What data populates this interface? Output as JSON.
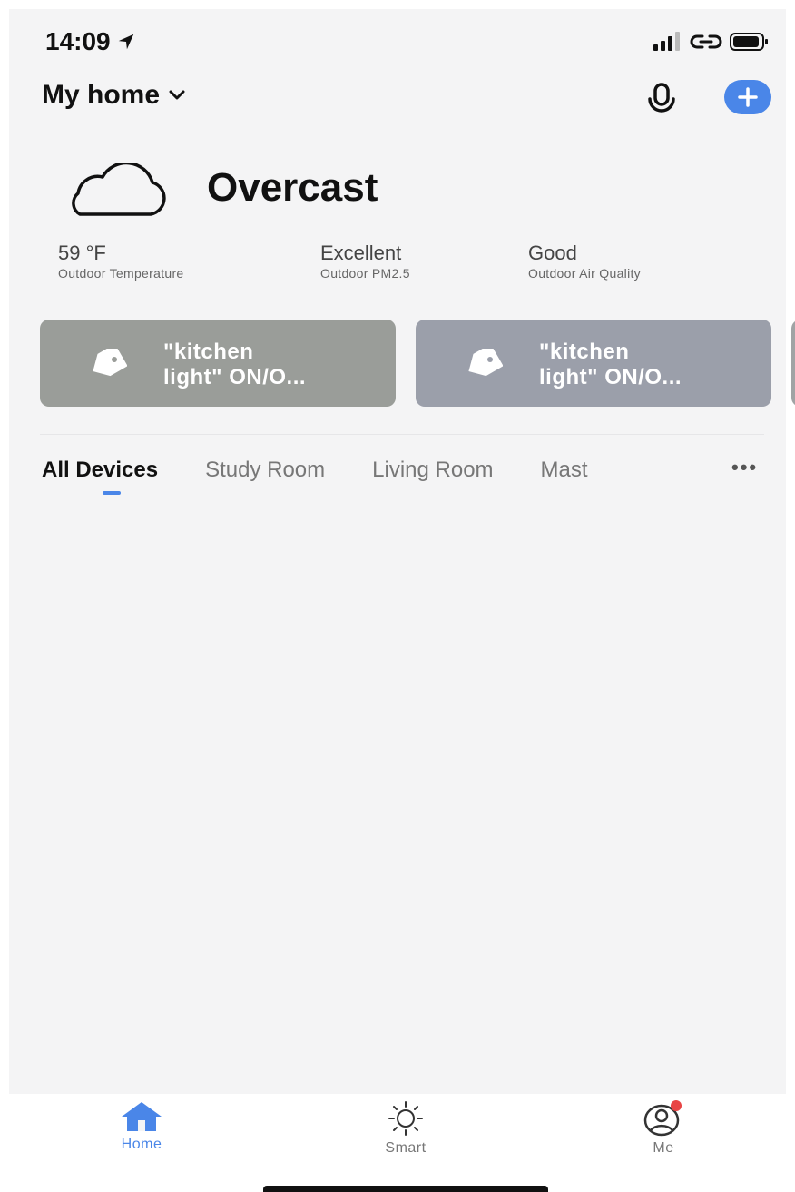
{
  "status_bar": {
    "time": "14:09",
    "icons": [
      "location-arrow-icon",
      "signal-icon",
      "link-icon",
      "battery-icon"
    ]
  },
  "header": {
    "title": "My home",
    "icons": [
      "chevron-down-icon",
      "microphone-icon",
      "plus-icon"
    ]
  },
  "weather": {
    "condition": "Overcast",
    "icon": "cloud-icon",
    "stats": [
      {
        "value": "59 °F",
        "label": "Outdoor Temperature"
      },
      {
        "value": "Excellent",
        "label": "Outdoor PM2.5"
      },
      {
        "value": "Good",
        "label": "Outdoor Air Quality"
      }
    ]
  },
  "scenes": [
    {
      "line1": "\"kitchen",
      "line2": "light\" ON/O...",
      "icon": "tag-icon",
      "color": "#9a9d99"
    },
    {
      "line1": "\"kitchen",
      "line2": "light\" ON/O...",
      "icon": "tag-icon",
      "color": "#9b9faa"
    }
  ],
  "tabs": {
    "items": [
      "All Devices",
      "Study Room",
      "Living Room",
      "Mast"
    ],
    "active": "All Devices",
    "more": "•••"
  },
  "tabbar": {
    "items": [
      {
        "label": "Home",
        "icon": "home-icon",
        "active": true
      },
      {
        "label": "Smart",
        "icon": "sun-icon",
        "active": false
      },
      {
        "label": "Me",
        "icon": "user-icon",
        "active": false
      }
    ]
  },
  "colors": {
    "accent": "#4a86e8",
    "badge": "#e84545",
    "background": "#f4f4f5"
  }
}
